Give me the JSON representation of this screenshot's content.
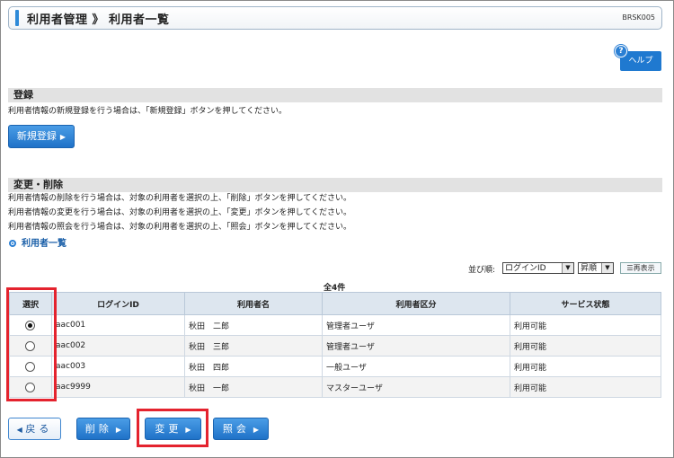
{
  "header": {
    "title": "利用者管理 》 利用者一覧",
    "screen_id": "BRSK005"
  },
  "help": {
    "icon_glyph": "?",
    "label": "ヘルプ"
  },
  "register": {
    "heading": "登録",
    "description": "利用者情報の新規登録を行う場合は、「新規登録」ボタンを押してください。",
    "button_label": "新規登録"
  },
  "modify": {
    "heading": "変更・削除",
    "descriptions": [
      "利用者情報の削除を行う場合は、対象の利用者を選択の上、「削除」ボタンを押してください。",
      "利用者情報の変更を行う場合は、対象の利用者を選択の上、「変更」ボタンを押してください。",
      "利用者情報の照会を行う場合は、対象の利用者を選択の上、「照会」ボタンを押してください。"
    ]
  },
  "list": {
    "subheading": "利用者一覧",
    "sort_label": "並び順:",
    "sort_field": "ログインID",
    "sort_order": "昇順",
    "redisplay_label": "再表示",
    "count": "全4件",
    "columns": [
      "選択",
      "ログインID",
      "利用者名",
      "利用者区分",
      "サービス状態"
    ],
    "rows": [
      {
        "selected": true,
        "login_id": "aac001",
        "name": "秋田　二郎",
        "type": "管理者ユーザ",
        "status": "利用可能"
      },
      {
        "selected": false,
        "login_id": "aac002",
        "name": "秋田　三郎",
        "type": "管理者ユーザ",
        "status": "利用可能"
      },
      {
        "selected": false,
        "login_id": "aac003",
        "name": "秋田　四郎",
        "type": "一般ユーザ",
        "status": "利用可能"
      },
      {
        "selected": false,
        "login_id": "aac9999",
        "name": "秋田　一郎",
        "type": "マスターユーザ",
        "status": "利用可能"
      }
    ]
  },
  "actions": {
    "back": "戻る",
    "delete": "削除",
    "change": "変更",
    "inquiry": "照会"
  },
  "colors": {
    "accent": "#1f72c8",
    "highlight": "#e4232e",
    "section_bg": "#e2e2e2"
  }
}
